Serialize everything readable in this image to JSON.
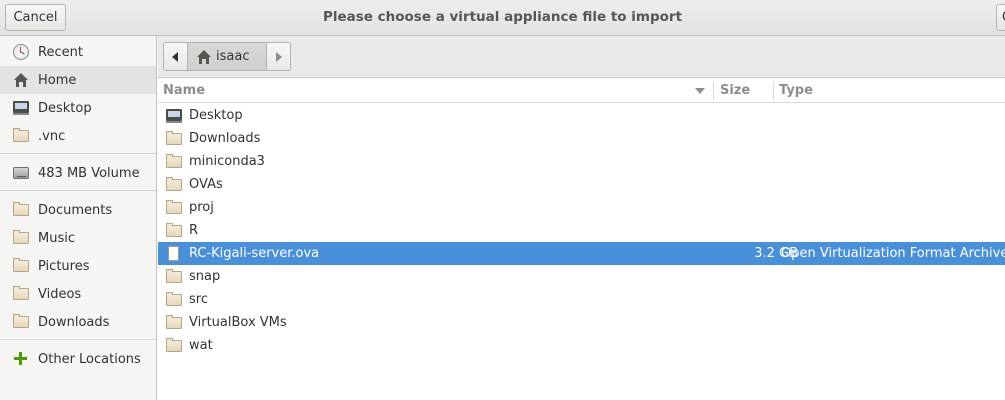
{
  "window": {
    "title": "Please choose a virtual appliance file to import",
    "cancel_label": "Cancel",
    "open_label_partial": "O"
  },
  "sidebar": {
    "items": [
      {
        "label": "Recent",
        "icon": "clock-icon"
      },
      {
        "label": "Home",
        "icon": "home-icon",
        "active": true
      },
      {
        "label": "Desktop",
        "icon": "desktop-icon"
      },
      {
        "label": ".vnc",
        "icon": "folder-icon"
      },
      {
        "label": "483 MB Volume",
        "icon": "drive-icon"
      },
      {
        "label": "Documents",
        "icon": "folder-icon"
      },
      {
        "label": "Music",
        "icon": "folder-icon"
      },
      {
        "label": "Pictures",
        "icon": "folder-icon"
      },
      {
        "label": "Videos",
        "icon": "folder-icon"
      },
      {
        "label": "Downloads",
        "icon": "folder-icon"
      },
      {
        "label": "Other Locations",
        "icon": "plus-icon"
      }
    ]
  },
  "pathbar": {
    "current": "isaac"
  },
  "filelist": {
    "columns": {
      "name": "Name",
      "size": "Size",
      "type": "Type"
    },
    "rows": [
      {
        "name": "Desktop",
        "icon": "desktop-icon",
        "size": "",
        "type": ""
      },
      {
        "name": "Downloads",
        "icon": "folder-icon",
        "size": "",
        "type": ""
      },
      {
        "name": "miniconda3",
        "icon": "folder-icon",
        "size": "",
        "type": ""
      },
      {
        "name": "OVAs",
        "icon": "folder-icon",
        "size": "",
        "type": ""
      },
      {
        "name": "proj",
        "icon": "folder-icon",
        "size": "",
        "type": ""
      },
      {
        "name": "R",
        "icon": "folder-icon",
        "size": "",
        "type": ""
      },
      {
        "name": "RC-Kigali-server.ova",
        "icon": "file-icon",
        "size": "3.2 GB",
        "type": "Open Virtualization Format Archive",
        "selected": true
      },
      {
        "name": "snap",
        "icon": "folder-icon",
        "size": "",
        "type": ""
      },
      {
        "name": "src",
        "icon": "folder-icon",
        "size": "",
        "type": ""
      },
      {
        "name": "VirtualBox VMs",
        "icon": "folder-icon",
        "size": "",
        "type": ""
      },
      {
        "name": "wat",
        "icon": "folder-icon",
        "size": "",
        "type": ""
      }
    ]
  },
  "colors": {
    "selection": "#4a90d9",
    "sidebar_active": "#e3e3e1",
    "folder_fill": "#e6d8bd"
  }
}
